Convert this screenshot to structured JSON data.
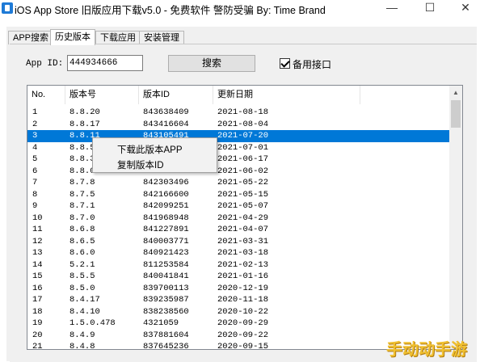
{
  "window": {
    "title": "iOS App Store 旧版应用下载v5.0 - 免费软件 警防受骗 By: Time Brand",
    "controls": [
      "—",
      "☐",
      "✕"
    ]
  },
  "tabs": [
    {
      "label": "APP搜索",
      "active": false
    },
    {
      "label": "历史版本",
      "active": true
    },
    {
      "label": "下载应用",
      "active": false
    },
    {
      "label": "安装管理",
      "active": false
    }
  ],
  "search": {
    "app_id_label": "App ID:",
    "app_id_value": "444934666",
    "search_button": "搜索",
    "backup_checkbox_label": "备用接口",
    "backup_checked": true
  },
  "table": {
    "columns": [
      "No.",
      "版本号",
      "版本ID",
      "更新日期"
    ],
    "selected_row": 2,
    "rows": [
      [
        "1",
        "8.8.20",
        "843638409",
        "2021-08-18"
      ],
      [
        "2",
        "8.8.17",
        "843416604",
        "2021-08-04"
      ],
      [
        "3",
        "8.8.11",
        "843105491",
        "2021-07-20"
      ],
      [
        "4",
        "8.8.5",
        "",
        "2021-07-01"
      ],
      [
        "5",
        "8.8.3",
        "",
        "2021-06-17"
      ],
      [
        "6",
        "8.8.0",
        "",
        "2021-06-02"
      ],
      [
        "7",
        "8.7.8",
        "842303496",
        "2021-05-22"
      ],
      [
        "8",
        "8.7.5",
        "842166600",
        "2021-05-15"
      ],
      [
        "9",
        "8.7.1",
        "842099251",
        "2021-05-07"
      ],
      [
        "10",
        "8.7.0",
        "841968948",
        "2021-04-29"
      ],
      [
        "11",
        "8.6.8",
        "841227891",
        "2021-04-07"
      ],
      [
        "12",
        "8.6.5",
        "840003771",
        "2021-03-31"
      ],
      [
        "13",
        "8.6.0",
        "840921423",
        "2021-03-18"
      ],
      [
        "14",
        "5.2.1",
        "811253584",
        "2021-02-13"
      ],
      [
        "15",
        "8.5.5",
        "840041841",
        "2021-01-16"
      ],
      [
        "16",
        "8.5.0",
        "839700113",
        "2020-12-19"
      ],
      [
        "17",
        "8.4.17",
        "839235987",
        "2020-11-18"
      ],
      [
        "18",
        "8.4.10",
        "838238560",
        "2020-10-22"
      ],
      [
        "19",
        "1.5.0.478",
        "4321059",
        "2020-09-29"
      ],
      [
        "20",
        "8.4.9",
        "837881604",
        "2020-09-22"
      ],
      [
        "21",
        "8.4.8",
        "837645236",
        "2020-09-15"
      ]
    ]
  },
  "context_menu": {
    "items": [
      "下载此版本APP",
      "复制版本ID"
    ]
  },
  "watermark": "手动动手游",
  "colors": {
    "selection": "#0078d7",
    "watermark": "#f0c030"
  }
}
